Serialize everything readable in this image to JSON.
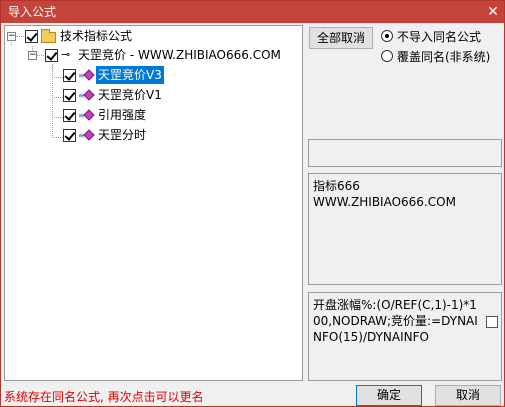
{
  "window": {
    "title": "导入公式",
    "close_symbol": "✕"
  },
  "tree": {
    "root": "技术指标公式",
    "group": "天罡竞价 - WWW.ZHIBIAO666.COM",
    "items": [
      "天罡竞价V3",
      "天罡竞价V1",
      "引用强度",
      "天罡分时"
    ],
    "selected_index": 0
  },
  "options": {
    "deselect_all": "全部取消",
    "no_import_same": "不导入同名公式",
    "overwrite_same": "覆盖同名(非系统)",
    "selected": "no_import_same"
  },
  "info": {
    "line1": "指标666",
    "line2": "WWW.ZHIBIAO666.COM"
  },
  "formula": {
    "text": "开盘涨幅%:(O/REF(C,1)-1)*100,NODRAW;竞价量:=DYNAINFO(15)/DYNAINFO"
  },
  "footer": {
    "status": "系统存在同名公式, 再次点击可以更名",
    "ok": "确定",
    "cancel": "取消"
  },
  "colors": {
    "titlebar": "#c4433a",
    "selection": "#0078d7",
    "status_text": "#e00000"
  }
}
